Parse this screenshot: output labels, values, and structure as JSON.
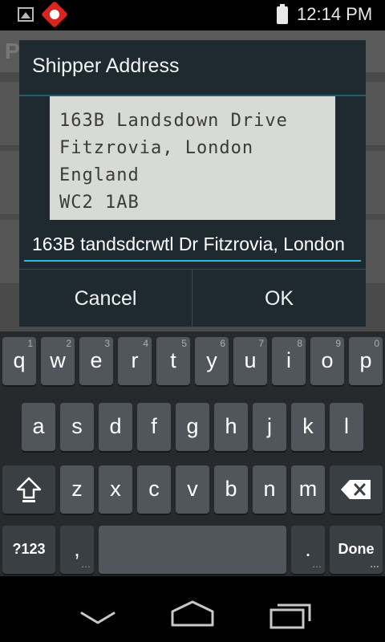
{
  "status_bar": {
    "time": "12:14 PM",
    "icons": [
      "image-icon",
      "app-notification-icon",
      "battery-icon"
    ]
  },
  "background_app": {
    "title_initial": "P"
  },
  "dialog": {
    "title": "Shipper Address",
    "scanned_lines": [
      "163B Landsdown Drive",
      "Fitzrovia, London",
      "England",
      "WC2 1AB"
    ],
    "address_value": "163B tandsdcrwtl Dr Fitzrovia, London",
    "cancel_label": "Cancel",
    "ok_label": "OK"
  },
  "keyboard": {
    "row1": [
      {
        "label": "q",
        "hint": "1"
      },
      {
        "label": "w",
        "hint": "2"
      },
      {
        "label": "e",
        "hint": "3"
      },
      {
        "label": "r",
        "hint": "4"
      },
      {
        "label": "t",
        "hint": "5"
      },
      {
        "label": "y",
        "hint": "6"
      },
      {
        "label": "u",
        "hint": "7"
      },
      {
        "label": "i",
        "hint": "8"
      },
      {
        "label": "o",
        "hint": "9"
      },
      {
        "label": "p",
        "hint": "0"
      }
    ],
    "row2": [
      "a",
      "s",
      "d",
      "f",
      "g",
      "h",
      "j",
      "k",
      "l"
    ],
    "row3": [
      "z",
      "x",
      "c",
      "v",
      "b",
      "n",
      "m"
    ],
    "symbols_label": "?123",
    "comma_label": ",",
    "period_label": ".",
    "done_label": "Done",
    "more_indicator": "…",
    "shift_icon": "shift-icon",
    "backspace_icon": "backspace-icon"
  },
  "nav_bar": {
    "icons": [
      "back-icon",
      "home-icon",
      "recent-apps-icon"
    ]
  }
}
